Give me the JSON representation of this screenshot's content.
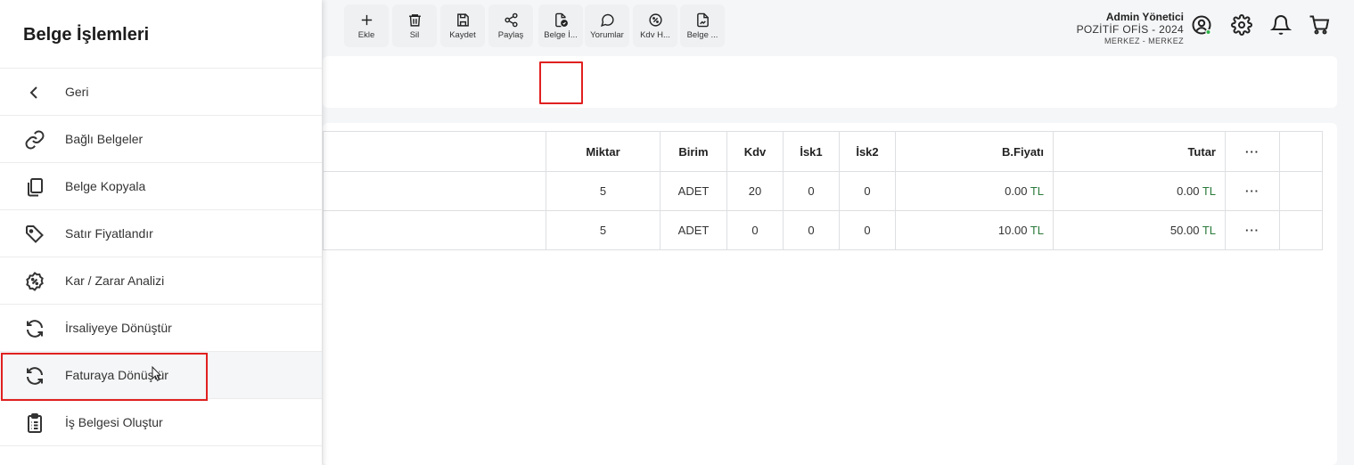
{
  "header": {
    "user_name": "Admin Yönetici",
    "company": "POZİTİF OFİS - 2024",
    "branch": "MERKEZ - MERKEZ",
    "icons": [
      "user-circle-icon",
      "gear-icon",
      "bell-icon",
      "cart-icon"
    ],
    "status_color": "#2fb34a"
  },
  "toolbar": {
    "buttons": [
      {
        "label": "Ekle",
        "icon": "plus-icon"
      },
      {
        "label": "Sil",
        "icon": "trash-icon"
      },
      {
        "label": "Kaydet",
        "icon": "save-icon"
      },
      {
        "label": "Paylaş",
        "icon": "share-icon"
      },
      {
        "label": "Belge İ...",
        "icon": "document-check-icon"
      },
      {
        "label": "Yorumlar",
        "icon": "comment-icon"
      },
      {
        "label": "Kdv H...",
        "icon": "percent-badge-icon"
      },
      {
        "label": "Belge ...",
        "icon": "document-image-icon"
      }
    ]
  },
  "table": {
    "headers": [
      "",
      "Miktar",
      "Birim",
      "Kdv",
      "İsk1",
      "İsk2",
      "B.Fiyatı",
      "Tutar",
      "···",
      ""
    ],
    "rows": [
      {
        "miktar": "5",
        "birim": "ADET",
        "kdv": "20",
        "isk1": "0",
        "isk2": "0",
        "bfiyat": "0.00",
        "tutar": "0.00",
        "currency": "TL",
        "menu": "···"
      },
      {
        "miktar": "5",
        "birim": "ADET",
        "kdv": "0",
        "isk1": "0",
        "isk2": "0",
        "bfiyat": "10.00",
        "tutar": "50.00",
        "currency": "TL",
        "menu": "···"
      }
    ]
  },
  "drawer": {
    "title": "Belge İşlemleri",
    "items": [
      {
        "label": "Geri",
        "icon": "chevron-left-icon"
      },
      {
        "label": "Bağlı Belgeler",
        "icon": "link-icon"
      },
      {
        "label": "Belge Kopyala",
        "icon": "copy-icon"
      },
      {
        "label": "Satır Fiyatlandır",
        "icon": "tag-icon"
      },
      {
        "label": "Kar / Zarar Analizi",
        "icon": "percent-badge-icon"
      },
      {
        "label": "İrsaliyeye Dönüştür",
        "icon": "refresh-icon"
      },
      {
        "label": "Faturaya Dönüştür",
        "icon": "refresh-icon"
      },
      {
        "label": "İş Belgesi Oluştur",
        "icon": "clipboard-icon"
      }
    ]
  },
  "highlight_color": "#e02020"
}
